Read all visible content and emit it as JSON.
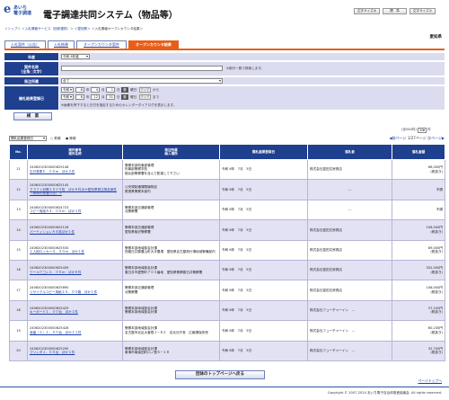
{
  "header": {
    "logo_line1": "あいち",
    "logo_line2": "電子調達",
    "system_title": "電子調達共同システム（物品等）",
    "buttons": [
      "文字サイズ大",
      "標　準",
      "文字サイズ小"
    ]
  },
  "breadcrumb": {
    "items": [
      "トップ",
      "入札情報サービス（団体選択）",
      "愛知県",
      "入札情報オープンカウンタ結果"
    ]
  },
  "prefecture": "愛知県",
  "tabs": [
    "入札案件（公告）",
    "入札結果",
    "オープンカウンタ案件",
    "オープンカウンタ結果"
  ],
  "form": {
    "nendo_label": "年度",
    "nendo_value": "令和 6年度",
    "anken_label": "案件名称\n(全角○文字)",
    "anken_note": "※部分一致で検索します。",
    "hacchu_label": "発注所属",
    "hacchu_value": "全て",
    "date_label": "開札結果登録日",
    "from": {
      "era": "令和",
      "year": "6",
      "month": "4",
      "day": "1",
      "cal": "暦",
      "dow": "曜日",
      "clear": "クリア",
      "suffix": "から"
    },
    "to": {
      "era": "令和",
      "year": "6",
      "month": "12",
      "day": "31",
      "cal": "暦",
      "dow": "曜日",
      "clear": "クリア",
      "suffix": "まで"
    },
    "date_note": "※画像を押下すると日付を指定するためのカレンダーダイアログを表示します。",
    "search_button": "検　索"
  },
  "result_count": "(全540件)",
  "page_size": "20",
  "page_size_suffix": "件",
  "sort": {
    "field": "開札結果登録日",
    "asc": "昇順",
    "desc": "降順"
  },
  "pager": {
    "prev": "前ページ",
    "current": "1/27ページ",
    "next": "次ページ"
  },
  "table": {
    "headers": [
      "No.",
      "案件番号\n案件名称",
      "発注所属\n納入場所",
      "開札結果登録日",
      "落札者",
      "落札金額"
    ],
    "rows": [
      {
        "no": "11",
        "num": "2406202300000625146",
        "name": "引戸書庫Ｅ．００ｍ　ほか２件",
        "org": "警察本部刑事部管理",
        "place": "刑事部警察学校\n陸北部警察署を含んで配達して下さい",
        "date": "令和 6年　7月　5日",
        "winner": "株式会社富田文房具店",
        "price": "66,000円\n(税抜き)"
      },
      {
        "no": "12",
        "num": "2406202300000625145",
        "name": "クラフト封筒１０００枚　ほか８件ほか愛知県発注物品案件（荷物の受渡方法）＞",
        "org": "公安規制通課閉鎖物品",
        "place": "尾張県警察本部内",
        "date": "令和 6年　7月　5日",
        "winner": "---",
        "price": "不調"
      },
      {
        "no": "13",
        "num": "2406202300000624723",
        "name": "コピー用紙Ａ４．００ｍ　ほか１件",
        "org": "警察本部交通部管理",
        "place": "北警察署",
        "date": "令和 6年　7月　5日",
        "winner": "---",
        "price": "不調"
      },
      {
        "no": "14",
        "num": "2406202300000625126",
        "name": "パーティションＡ４枚ほか１件",
        "org": "警察本部交通部管理",
        "place": "愛知県稲沢警察署",
        "date": "令和 6年　7月　5日",
        "winner": "株式会社富田文房具店",
        "price": "106,000円\n(税抜き)"
      },
      {
        "no": "15",
        "num": "2406202300000625534",
        "name": "１人用ロッカー４．００ｍ　ほか１件",
        "org": "警察本部地域部会計課",
        "place": "西春日井郡豊山町大字豊場　愛知県名古屋飛行場地域警備部内",
        "date": "令和 6年　7月　5日",
        "winner": "株式会社富田文房具店",
        "price": "89,000円\n(税抜き)"
      },
      {
        "no": "16",
        "num": "2406202300000625439",
        "name": "ワールワゴン２．００ｍ　ほか８件",
        "org": "警察本部地域部会計課",
        "place": "春日井市愛野町７０３番地　愛知県警察春日井警察署",
        "date": "令和 6年　7月　5日",
        "winner": "株式会社富田文房具店",
        "price": "352,000円\n(税抜き)"
      },
      {
        "no": "17",
        "num": "2406202300000625890",
        "name": "リサイクルコピー用紙２０．００箱　ほか１件",
        "org": "警察本部交通部管理",
        "place": "北警察署",
        "date": "令和 6年　7月　5日",
        "winner": "株式会社富田文房具店",
        "price": "106,000円\n(税抜き)"
      },
      {
        "no": "18",
        "num": "2406202300000625429",
        "name": "キーボード１．００台　ほか１件",
        "org": "警察本部地域部会計課",
        "place": "警察本部地域部会計課",
        "date": "令和 6年　7月　5日",
        "winner": "株式会社フューチャーイン　…",
        "price": "57,100円\n(税抜き)"
      },
      {
        "no": "19",
        "num": "2406202300000625428",
        "name": "液晶（１）１．００台　ほか１１件",
        "org": "警察本部地域部会計課",
        "place": "名古屋市北区大曽根１−８２　名北分庁舎　広報課保安係",
        "date": "令和 6年　7月　5日",
        "winner": "株式会社フューチャーイン　…",
        "price": "60,230円\n(税抜き)"
      },
      {
        "no": "20",
        "num": "2406202300000625290",
        "name": "プリンタ１．００台　ほか１件",
        "org": "警察本部地域部会計課",
        "place": "東海市南柴田町ロノ割５−１８",
        "date": "令和 6年　7月　5日",
        "winner": "株式会社フューチャーイン　…",
        "price": "32,700円\n(税抜き)"
      }
    ]
  },
  "top_button": "団体のトップページへ戻る",
  "page_top": "ページトップへ",
  "copyright": "Copyright © 2007-2024 あいち電子自治体推進協議会. All rights reserved."
}
